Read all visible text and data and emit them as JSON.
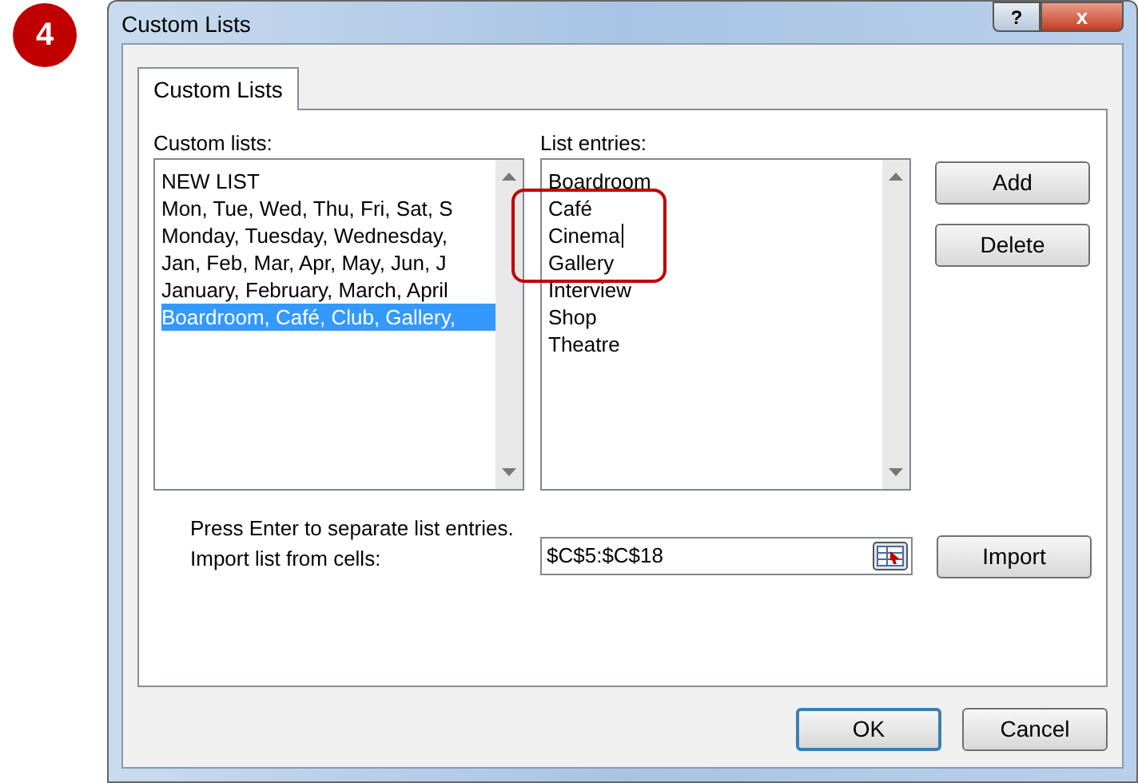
{
  "step_badge": "4",
  "window": {
    "title": "Custom Lists",
    "help_button": "?",
    "close_button": "x"
  },
  "tabs": [
    {
      "label": "Custom Lists",
      "selected": true
    }
  ],
  "custom_lists": {
    "label": "Custom lists:",
    "items": [
      {
        "text": "NEW LIST",
        "selected": false
      },
      {
        "text": "Mon, Tue, Wed, Thu, Fri, Sat, S",
        "selected": false
      },
      {
        "text": "Monday, Tuesday, Wednesday,",
        "selected": false
      },
      {
        "text": "Jan, Feb, Mar, Apr, May, Jun, J",
        "selected": false
      },
      {
        "text": "January, February, March, April",
        "selected": false
      },
      {
        "text": "Boardroom, Café, Club, Gallery,",
        "selected": true
      }
    ]
  },
  "list_entries": {
    "label": "List entries:",
    "groups": [
      {
        "circled": false,
        "items": [
          {
            "text": "Boardroom",
            "cursor": false
          }
        ]
      },
      {
        "circled": true,
        "items": [
          {
            "text": "Café",
            "cursor": false
          },
          {
            "text": "Cinema",
            "cursor": true
          },
          {
            "text": "Gallery",
            "cursor": false
          }
        ]
      },
      {
        "circled": false,
        "items": [
          {
            "text": "Interview",
            "cursor": false
          },
          {
            "text": "Shop",
            "cursor": false
          },
          {
            "text": "Theatre",
            "cursor": false
          }
        ]
      }
    ]
  },
  "side_buttons": [
    "Add",
    "Delete"
  ],
  "hint": "Press Enter to separate list entries.",
  "import": {
    "label": "Import list from cells:",
    "value": "$C$5:$C$18",
    "button": "Import"
  },
  "buttons": [
    {
      "label": "OK",
      "default": true
    },
    {
      "label": "Cancel",
      "default": false
    }
  ]
}
